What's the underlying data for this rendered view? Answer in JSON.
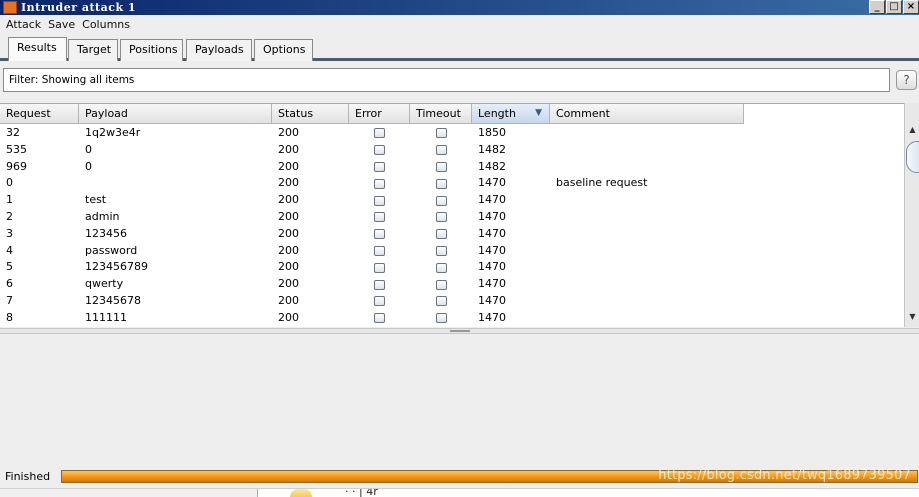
{
  "window": {
    "title": "Intruder attack 1",
    "controls": [
      "_",
      "□",
      "×"
    ]
  },
  "menu": [
    "Attack",
    "Save",
    "Columns"
  ],
  "tabs": [
    "Results",
    "Target",
    "Positions",
    "Payloads",
    "Options"
  ],
  "active_tab": "Results",
  "filter": {
    "text": "Filter: Showing all items",
    "help_label": "?"
  },
  "table": {
    "columns": [
      "Request",
      "Payload",
      "Status",
      "Error",
      "Timeout",
      "Length",
      "Comment"
    ],
    "sorted_column": "Length",
    "sort_direction": "descending",
    "rows": [
      {
        "request": "32",
        "payload": "1q2w3e4r",
        "status": "200",
        "error": false,
        "timeout": false,
        "length": "1850",
        "comment": ""
      },
      {
        "request": "535",
        "payload": "0",
        "status": "200",
        "error": false,
        "timeout": false,
        "length": "1482",
        "comment": ""
      },
      {
        "request": "969",
        "payload": "0",
        "status": "200",
        "error": false,
        "timeout": false,
        "length": "1482",
        "comment": ""
      },
      {
        "request": "0",
        "payload": "",
        "status": "200",
        "error": false,
        "timeout": false,
        "length": "1470",
        "comment": "baseline request"
      },
      {
        "request": "1",
        "payload": "test",
        "status": "200",
        "error": false,
        "timeout": false,
        "length": "1470",
        "comment": ""
      },
      {
        "request": "2",
        "payload": "admin",
        "status": "200",
        "error": false,
        "timeout": false,
        "length": "1470",
        "comment": ""
      },
      {
        "request": "3",
        "payload": "123456",
        "status": "200",
        "error": false,
        "timeout": false,
        "length": "1470",
        "comment": ""
      },
      {
        "request": "4",
        "payload": "password",
        "status": "200",
        "error": false,
        "timeout": false,
        "length": "1470",
        "comment": ""
      },
      {
        "request": "5",
        "payload": "123456789",
        "status": "200",
        "error": false,
        "timeout": false,
        "length": "1470",
        "comment": ""
      },
      {
        "request": "6",
        "payload": "qwerty",
        "status": "200",
        "error": false,
        "timeout": false,
        "length": "1470",
        "comment": ""
      },
      {
        "request": "7",
        "payload": "12345678",
        "status": "200",
        "error": false,
        "timeout": false,
        "length": "1470",
        "comment": ""
      },
      {
        "request": "8",
        "payload": "111111",
        "status": "200",
        "error": false,
        "timeout": false,
        "length": "1470",
        "comment": ""
      }
    ]
  },
  "status": {
    "label": "Finished",
    "progress_percent": 100,
    "watermark": "https://blog.csdn.net/twq1689739507"
  },
  "taskbar": {
    "fragment_text": "·  · | 4r"
  },
  "colors": {
    "titlebar": "#0a246a",
    "progress_fill": "#f0900c",
    "tab_underline": "#4f5a6d"
  }
}
